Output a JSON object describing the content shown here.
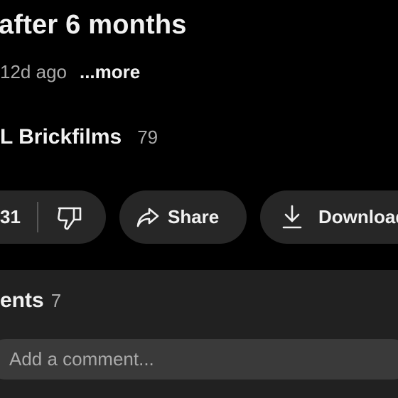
{
  "video": {
    "title": "after 6 months",
    "age": "12d ago",
    "more_label": "...more"
  },
  "channel": {
    "name": "L Brickfilms",
    "subscriber_count": "79"
  },
  "actions": {
    "like_count": "31",
    "share_label": "Share",
    "download_label": "Download"
  },
  "comments": {
    "label": "ents",
    "count": "7",
    "input_placeholder": "Add a comment..."
  },
  "icons": {
    "dislike": "thumbs-down-icon",
    "share": "share-arrow-icon",
    "download": "download-icon"
  },
  "colors": {
    "background": "#000000",
    "pill": "#272727",
    "panel": "#212121",
    "input": "#3a3a3a",
    "text_primary": "#f1f1f1",
    "text_secondary": "#aaaaaa"
  }
}
